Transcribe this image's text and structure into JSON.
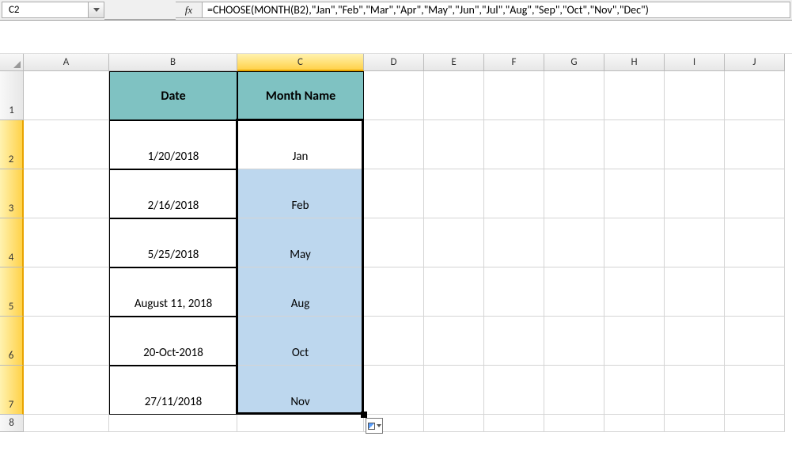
{
  "name_box": "C2",
  "fx_label": "fx",
  "formula": "=CHOOSE(MONTH(B2),\"Jan\",\"Feb\",\"Mar\",\"Apr\",\"May\",\"Jun\",\"Jul\",\"Aug\",\"Sep\",\"Oct\",\"Nov\",\"Dec\")",
  "columns": [
    "A",
    "B",
    "C",
    "D",
    "E",
    "F",
    "G",
    "H",
    "I",
    "J"
  ],
  "rows": [
    "1",
    "2",
    "3",
    "4",
    "5",
    "6",
    "7",
    "8"
  ],
  "selected_column": "C",
  "selection_rows": [
    "2",
    "3",
    "4",
    "5",
    "6",
    "7"
  ],
  "table": {
    "header_b": "Date",
    "header_c": "Month Name",
    "data": [
      {
        "b": "1/20/2018",
        "c": "Jan"
      },
      {
        "b": "2/16/2018",
        "c": "Feb"
      },
      {
        "b": "5/25/2018",
        "c": "May"
      },
      {
        "b": "August 11, 2018",
        "c": "Aug"
      },
      {
        "b": "20-Oct-2018",
        "c": "Oct"
      },
      {
        "b": "27/11/2018",
        "c": "Nov"
      }
    ]
  }
}
